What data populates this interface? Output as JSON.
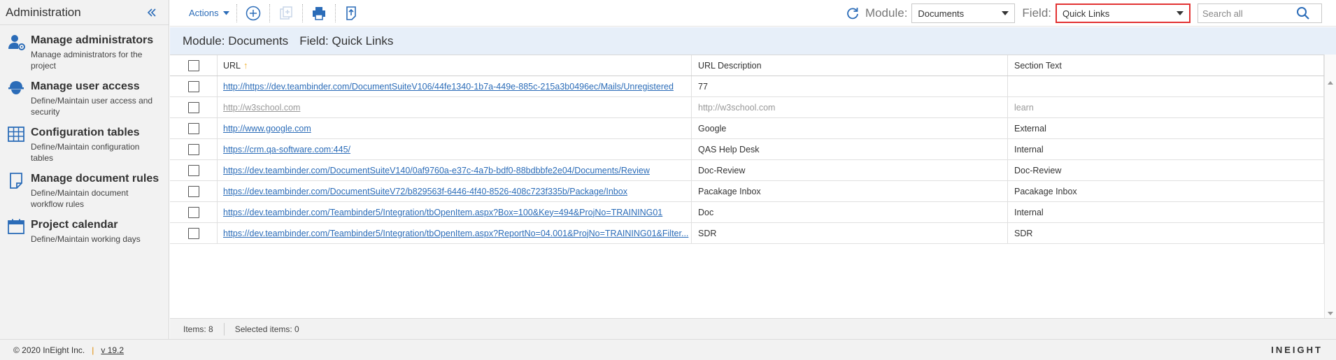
{
  "sidebar": {
    "title": "Administration",
    "items": [
      {
        "label": "Manage administrators",
        "desc": "Manage administrators for the project",
        "icon": "user-gear-icon"
      },
      {
        "label": "Manage user access",
        "desc": "Define/Maintain user access and security",
        "icon": "hardhat-user-icon"
      },
      {
        "label": "Configuration tables",
        "desc": "Define/Maintain configuration tables",
        "icon": "table-grid-icon"
      },
      {
        "label": "Manage document rules",
        "desc": "Define/Maintain document workflow rules",
        "icon": "document-icon"
      },
      {
        "label": "Project calendar",
        "desc": "Define/Maintain working days",
        "icon": "calendar-icon"
      }
    ]
  },
  "toolbar": {
    "actions_label": "Actions",
    "module_label": "Module:",
    "module_value": "Documents",
    "field_label": "Field:",
    "field_value": "Quick Links",
    "search_placeholder": "Search all"
  },
  "band": {
    "module_text": "Module: Documents",
    "field_text": "Field: Quick Links"
  },
  "grid": {
    "columns": [
      "URL",
      "URL Description",
      "Section Text"
    ],
    "rows": [
      {
        "url": "http://https://dev.teambinder.com/DocumentSuiteV106/44fe1340-1b7a-449e-885c-215a3b0496ec/Mails/Unregistered",
        "desc": "77",
        "section": ""
      },
      {
        "url": "http://w3school.com",
        "desc": "http://w3school.com",
        "section": "learn"
      },
      {
        "url": "http://www.google.com",
        "desc": "Google",
        "section": "External"
      },
      {
        "url": "https://crm.qa-software.com:445/",
        "desc": "QAS Help Desk",
        "section": "Internal"
      },
      {
        "url": "https://dev.teambinder.com/DocumentSuiteV140/0af9760a-e37c-4a7b-bdf0-88bdbbfe2e04/Documents/Review",
        "desc": "Doc-Review",
        "section": "Doc-Review"
      },
      {
        "url": "https://dev.teambinder.com/DocumentSuiteV72/b829563f-6446-4f40-8526-408c723f335b/Package/Inbox",
        "desc": "Pacakage Inbox",
        "section": "Pacakage Inbox"
      },
      {
        "url": "https://dev.teambinder.com/Teambinder5/Integration/tbOpenItem.aspx?Box=100&Key=494&ProjNo=TRAINING01",
        "desc": "Doc",
        "section": "Internal"
      },
      {
        "url": "https://dev.teambinder.com/Teambinder5/Integration/tbOpenItem.aspx?ReportNo=04.001&ProjNo=TRAINING01&Filter...",
        "desc": "SDR",
        "section": "SDR"
      }
    ]
  },
  "status": {
    "items_text": "Items: 8",
    "selected_text": "Selected items: 0"
  },
  "footer": {
    "copyright": "© 2020 InEight Inc.",
    "separator": "|",
    "version": "v 19.2",
    "brand": "INEIGHT"
  },
  "colors": {
    "accent": "#2b6cb8",
    "highlight": "#e23232",
    "band": "#e7eff9"
  }
}
